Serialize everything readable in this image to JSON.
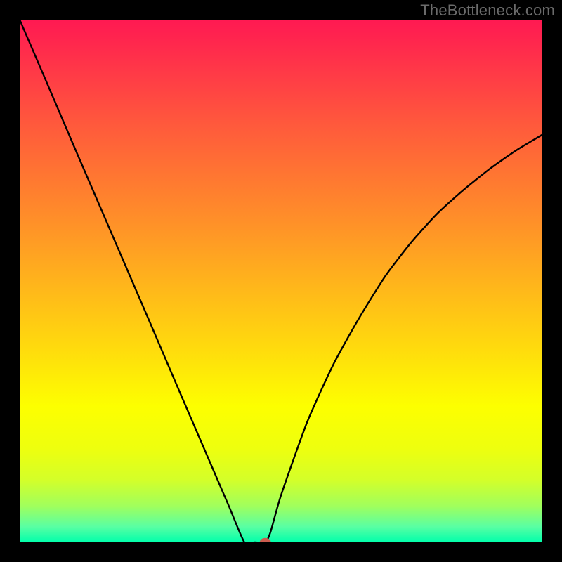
{
  "watermark": "TheBottleneck.com",
  "chart_data": {
    "type": "line",
    "title": "",
    "xlabel": "",
    "ylabel": "",
    "xlim": [
      0,
      100
    ],
    "ylim": [
      0,
      100
    ],
    "grid": false,
    "legend": false,
    "series": [
      {
        "name": "curve",
        "x": [
          0,
          5,
          10,
          15,
          20,
          25,
          30,
          35,
          40,
          43,
          45,
          47,
          48,
          50,
          55,
          60,
          65,
          70,
          75,
          80,
          85,
          90,
          95,
          100
        ],
        "y": [
          100,
          88.4,
          76.7,
          65.1,
          53.5,
          41.9,
          30.2,
          18.6,
          7.0,
          0.0,
          0.0,
          0.0,
          2.0,
          9.0,
          23.0,
          34.0,
          43.0,
          51.0,
          57.5,
          63.0,
          67.5,
          71.5,
          75.0,
          78.0
        ]
      }
    ],
    "marker": {
      "x": 47,
      "y": 0,
      "color": "#cc5c4f"
    },
    "gradient_stops": [
      {
        "pos": 0.0,
        "color": "#ff1952"
      },
      {
        "pos": 0.2,
        "color": "#ff593c"
      },
      {
        "pos": 0.4,
        "color": "#ff9427"
      },
      {
        "pos": 0.5,
        "color": "#ffb31c"
      },
      {
        "pos": 0.62,
        "color": "#ffd80e"
      },
      {
        "pos": 0.74,
        "color": "#fdff00"
      },
      {
        "pos": 0.82,
        "color": "#eeff0e"
      },
      {
        "pos": 0.88,
        "color": "#d4ff29"
      },
      {
        "pos": 0.93,
        "color": "#a1ff5c"
      },
      {
        "pos": 0.97,
        "color": "#59ffa3"
      },
      {
        "pos": 1.0,
        "color": "#00ffab"
      }
    ]
  }
}
